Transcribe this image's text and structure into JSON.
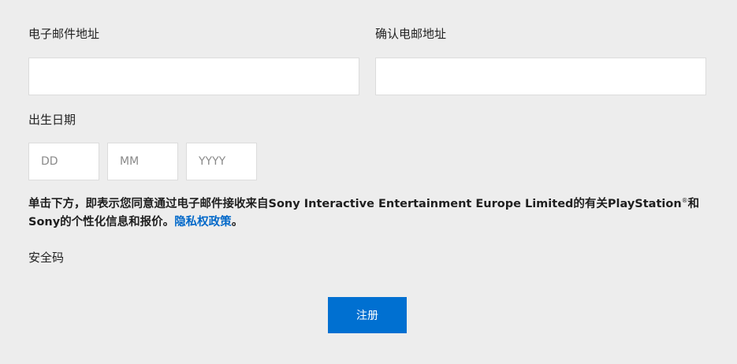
{
  "email": {
    "label": "电子邮件地址",
    "value": "",
    "placeholder": ""
  },
  "confirm_email": {
    "label": "确认电邮地址",
    "value": "",
    "placeholder": ""
  },
  "birth_date": {
    "label": "出生日期",
    "day_placeholder": "DD",
    "month_placeholder": "MM",
    "year_placeholder": "YYYY"
  },
  "consent": {
    "line1_before_reg": "单击下方，即表示您同意通过电子邮件接收来自Sony Interactive Entertainment Europe Limited的有关PlayStation",
    "reg_mark": "®",
    "line1_after_reg": "和Sony的个性化信息和报价。",
    "privacy_link": "隐私权政策",
    "period": "。"
  },
  "security_code": {
    "label": "安全码"
  },
  "submit": {
    "label": "注册",
    "color": "#0070d1"
  },
  "colors": {
    "background": "#ededed",
    "link": "#0068c9",
    "input_background": "#ffffff"
  }
}
